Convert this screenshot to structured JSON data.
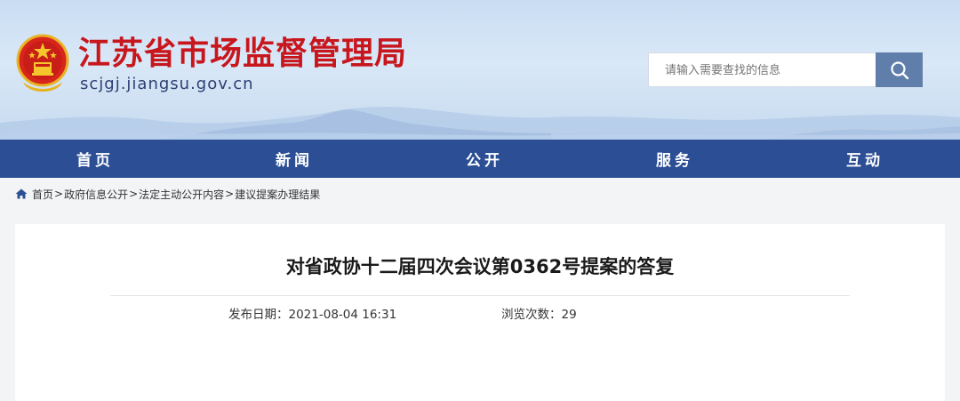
{
  "header": {
    "site_title": "江苏省市场监督管理局",
    "site_domain": "scjgj.jiangsu.gov.cn",
    "emblem_icon": "national-emblem-icon",
    "search": {
      "placeholder": "请输入需要查找的信息",
      "button_icon": "search-icon"
    }
  },
  "nav": {
    "items": [
      {
        "label": "首页"
      },
      {
        "label": "新闻"
      },
      {
        "label": "公开"
      },
      {
        "label": "服务"
      },
      {
        "label": "互动"
      }
    ]
  },
  "breadcrumb": {
    "icon": "home-icon",
    "separator": ">",
    "items": [
      "首页",
      "政府信息公开",
      "法定主动公开内容",
      "建议提案办理结果"
    ]
  },
  "article": {
    "title": "对省政协十二届四次会议第0362号提案的答复",
    "publish_label": "发布日期：",
    "publish_value": "2021-08-04 16:31",
    "views_label": "浏览次数：",
    "views_value": "29"
  },
  "colors": {
    "title_red": "#c8161d",
    "nav_blue": "#2b4e94",
    "search_button": "#5f7eaa",
    "domain_text": "#2a3f73"
  }
}
